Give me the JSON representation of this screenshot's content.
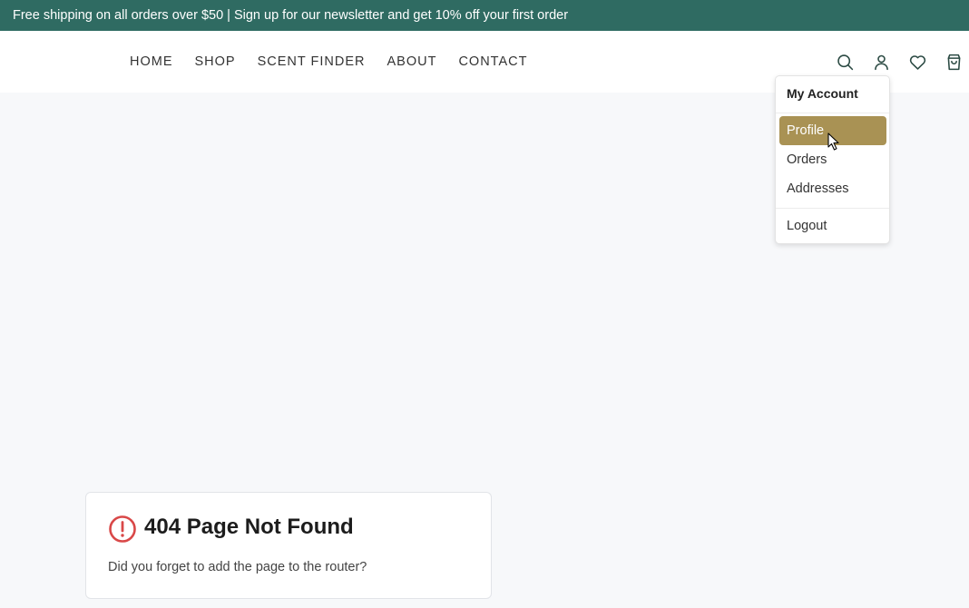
{
  "announcement": "Free shipping on all orders over $50 | Sign up for our newsletter and get 10% off your first order",
  "nav": {
    "items": [
      "HOME",
      "SHOP",
      "SCENT FINDER",
      "ABOUT",
      "CONTACT"
    ]
  },
  "header_icons": [
    "search-icon",
    "user-icon",
    "heart-icon",
    "shopping-bag-icon"
  ],
  "account_menu": {
    "title": "My Account",
    "items": [
      "Profile",
      "Orders",
      "Addresses"
    ],
    "logout": "Logout",
    "active_item": "Profile"
  },
  "error_card": {
    "title": "404 Page Not Found",
    "message": "Did you forget to add the page to the router?"
  },
  "colors": {
    "announcement_bg": "#2f6b62",
    "accent": "#a99254",
    "icon": "#2b4a43",
    "error": "#d94848"
  }
}
